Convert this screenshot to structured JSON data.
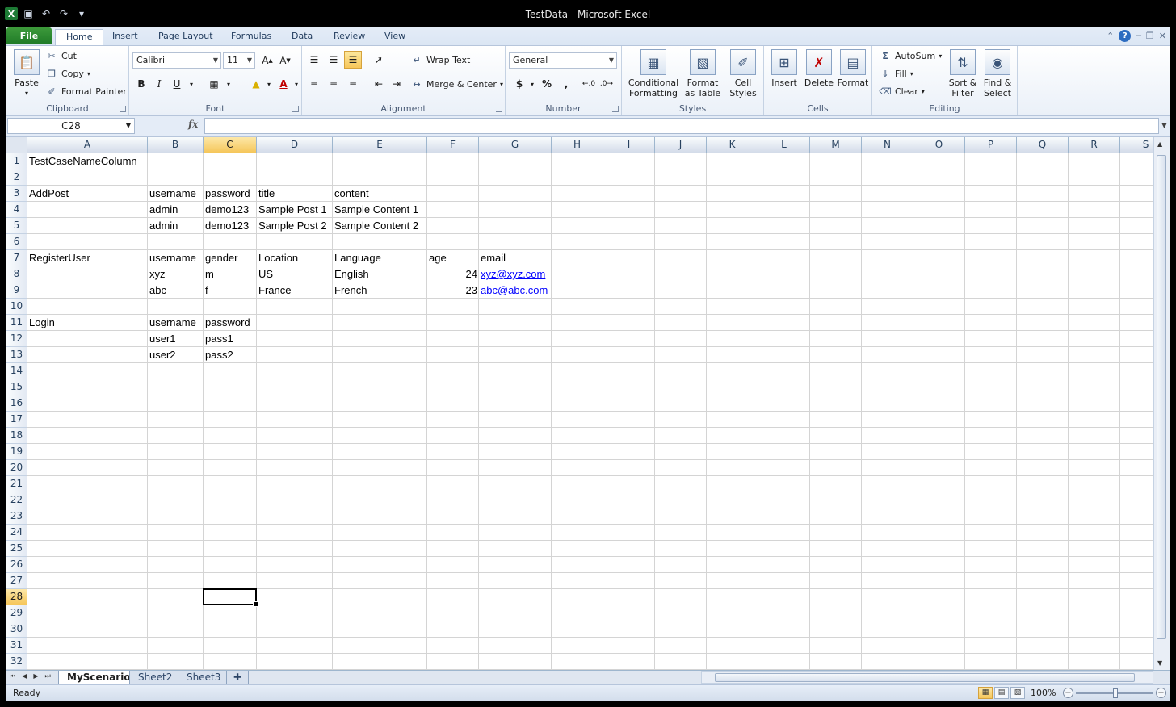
{
  "window": {
    "title": "TestData  -  Microsoft Excel"
  },
  "tabs": [
    "File",
    "Home",
    "Insert",
    "Page Layout",
    "Formulas",
    "Data",
    "Review",
    "View"
  ],
  "ribbon": {
    "clipboard": {
      "label": "Clipboard",
      "paste": "Paste",
      "cut": "Cut",
      "copy": "Copy",
      "format_painter": "Format Painter"
    },
    "font": {
      "label": "Font",
      "name": "Calibri",
      "size": "11",
      "bold": "B",
      "italic": "I",
      "underline": "U"
    },
    "alignment": {
      "label": "Alignment",
      "wrap_text": "Wrap Text",
      "merge_center": "Merge & Center"
    },
    "number": {
      "label": "Number",
      "format": "General",
      "currency": "$",
      "percent": "%",
      "comma": ","
    },
    "styles": {
      "label": "Styles",
      "conditional_1": "Conditional",
      "conditional_2": "Formatting",
      "table_1": "Format",
      "table_2": "as Table",
      "cell_1": "Cell",
      "cell_2": "Styles"
    },
    "cells": {
      "label": "Cells",
      "insert": "Insert",
      "delete": "Delete",
      "format": "Format"
    },
    "editing": {
      "label": "Editing",
      "autosum": "AutoSum",
      "fill": "Fill",
      "clear": "Clear",
      "sort_1": "Sort &",
      "sort_2": "Filter",
      "find_1": "Find &",
      "find_2": "Select"
    }
  },
  "formula_bar": {
    "name_box": "C28",
    "fx": "fx",
    "value": ""
  },
  "columns": [
    "A",
    "B",
    "C",
    "D",
    "E",
    "F",
    "G",
    "H",
    "I",
    "J",
    "K",
    "L",
    "M",
    "N",
    "O",
    "P",
    "Q",
    "R",
    "S"
  ],
  "rows": [
    "1",
    "2",
    "3",
    "4",
    "5",
    "6",
    "7",
    "8",
    "9",
    "10",
    "11",
    "12",
    "13",
    "14",
    "15",
    "16",
    "17",
    "18",
    "19",
    "20",
    "21",
    "22",
    "23",
    "24",
    "25",
    "26",
    "27",
    "28",
    "29",
    "30",
    "31",
    "32"
  ],
  "selected_cell": "C28",
  "cells": {
    "A1": "TestCaseNameColumn",
    "A3": "AddPost",
    "B3": "username",
    "C3": "password",
    "D3": "title",
    "E3": "content",
    "B4": "admin",
    "C4": "demo123",
    "D4": "Sample Post 1",
    "E4": "Sample Content 1",
    "B5": "admin",
    "C5": "demo123",
    "D5": "Sample Post 2",
    "E5": "Sample Content 2",
    "A7": "RegisterUser",
    "B7": "username",
    "C7": "gender",
    "D7": "Location",
    "E7": "Language",
    "F7": "age",
    "G7": "email",
    "B8": "xyz",
    "C8": "m",
    "D8": "US",
    "E8": "English",
    "F8": "24",
    "G8": "xyz@xyz.com",
    "B9": "abc",
    "C9": "f",
    "D9": "France",
    "E9": "French",
    "F9": "23",
    "G9": "abc@abc.com",
    "A11": "Login",
    "B11": "username",
    "C11": "password",
    "B12": "user1",
    "C12": "pass1",
    "B13": "user2",
    "C13": "pass2"
  },
  "sheets": [
    "MyScenario",
    "Sheet2",
    "Sheet3"
  ],
  "active_sheet": "MyScenario",
  "status": {
    "text": "Ready",
    "zoom": "100%"
  }
}
